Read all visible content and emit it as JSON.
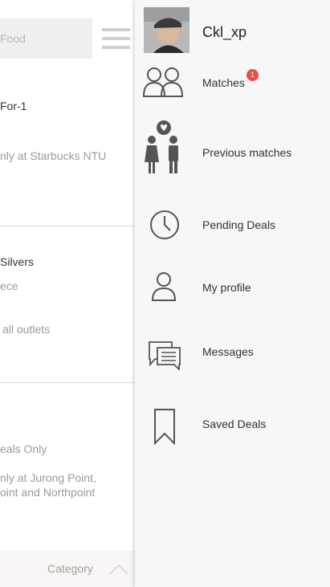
{
  "background": {
    "search_placeholder": "Food",
    "deal1": {
      "title": "For-1",
      "detail": "nly at Starbucks NTU"
    },
    "deal2": {
      "title": "Silvers",
      "sub": "ece",
      "detail": "all outlets"
    },
    "deal3": {
      "title": "eals Only",
      "detail_line1": "nly at Jurong Point,",
      "detail_line2": "oint and Northpoint"
    },
    "category_label": "Category"
  },
  "drawer": {
    "username": "Ckl_xp",
    "matches_badge": "1",
    "items": [
      {
        "label": "Matches",
        "icon": "people-icon"
      },
      {
        "label": "Previous matches",
        "icon": "couple-heart-icon"
      },
      {
        "label": "Pending Deals",
        "icon": "clock-icon"
      },
      {
        "label": "My profile",
        "icon": "person-icon"
      },
      {
        "label": "Messages",
        "icon": "chat-icon"
      },
      {
        "label": "Saved Deals",
        "icon": "bookmark-icon"
      }
    ]
  },
  "colors": {
    "badge": "#f04b4b",
    "drawer_bg": "#f7f7f7",
    "icon": "#555555"
  }
}
